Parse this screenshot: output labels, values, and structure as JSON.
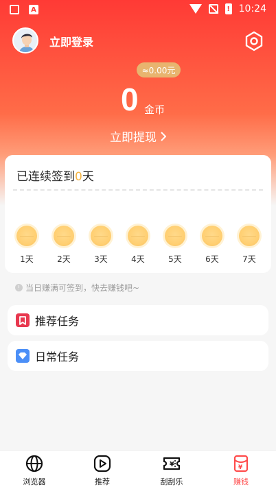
{
  "status_bar": {
    "time": "10:24",
    "left_icons": [
      "qr-icon",
      "a-icon"
    ],
    "right_icons": [
      "wifi-icon",
      "no-signal-icon",
      "battery-icon"
    ],
    "a_glyph": "A"
  },
  "header": {
    "login_text": "立即登录",
    "settings_icon": "settings-icon"
  },
  "wallet": {
    "cash": "≈0.00元",
    "coins": "0",
    "coin_unit": "金币",
    "withdraw": "立即提现"
  },
  "sign_in": {
    "title_prefix": "已连续签到",
    "days": "0",
    "title_suffix": "天",
    "day_labels": [
      "1天",
      "2天",
      "3天",
      "4天",
      "5天",
      "6天",
      "7天"
    ]
  },
  "tip": {
    "text": "当日赚满可签到，快去赚钱吧~"
  },
  "tasks": [
    {
      "label": "推荐任务",
      "icon": "bookmark-icon",
      "color": "#e8384f"
    },
    {
      "label": "日常任务",
      "icon": "diamond-icon",
      "color": "#4b8ff7"
    }
  ],
  "bottom_nav": {
    "items": [
      {
        "label": "浏览器",
        "icon": "globe-icon"
      },
      {
        "label": "推荐",
        "icon": "play-icon"
      },
      {
        "label": "刮刮乐",
        "icon": "ticket-icon"
      },
      {
        "label": "赚钱",
        "icon": "money-envelope-icon"
      }
    ],
    "active_index": 3,
    "active_color": "#ff4b4b"
  },
  "colors": {
    "brand": "#ff3a35",
    "gold": "#f5b544"
  }
}
